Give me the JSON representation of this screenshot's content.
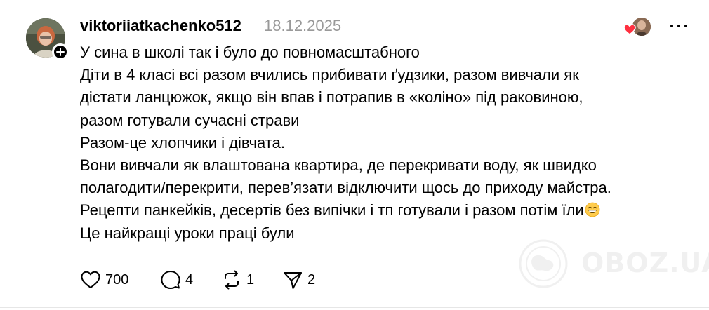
{
  "post": {
    "username": "viktoriiatkachenko512",
    "date": "18.12.2025",
    "body_lines": [
      "У сина в школі так і було до повномасштабного",
      "Діти в 4 класі всі разом вчились прибивати ґудзики, разом вивчали як",
      "дістати ланцюжок, якщо він впав і потрапив в «коліно» під раковиною,",
      "разом готували сучасні страви",
      "Разом-це хлопчики і дівчата.",
      "Вони вивчали як влаштована квартира, де перекривати воду, як швидко",
      "полагодити/перекрити, перев’язати відключити щось до приходу майстра.",
      "Рецепти панкейків, десертів без випічки і тп готували і разом потім їли",
      "Це найкращі уроки праці були"
    ],
    "emoji_name": "grinning-face-with-smiling-eyes-emoji"
  },
  "actions": {
    "likes": "700",
    "comments": "4",
    "reposts": "1",
    "shares": "2"
  },
  "watermark": {
    "text": "OBOZ.UA"
  },
  "colors": {
    "text": "#000000",
    "muted": "#999999",
    "liked_heart": "#ff3040",
    "watermark": "#e2e2e2"
  }
}
